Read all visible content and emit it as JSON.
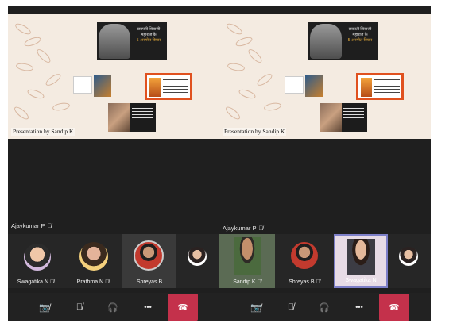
{
  "screens": {
    "left": {
      "slide_caption": "Presentation by Sandip K",
      "slide_title_line1": "छत्रपती शिवाजी",
      "slide_title_line2": "महाराज के",
      "slide_title_line3": "5 अनमोल विचार",
      "presenter_name": "Ajaykumar P",
      "participants": [
        {
          "name": "Swagatika N",
          "avatar": "avatar-photo",
          "muted": true
        },
        {
          "name": "Prathma N",
          "avatar": "avatar-photo",
          "muted": true
        },
        {
          "name": "Shreyas B",
          "avatar": "avatar-photo",
          "muted": false,
          "active": true
        },
        {
          "name": "",
          "avatar": "avatar-photo",
          "muted": false
        }
      ]
    },
    "right": {
      "slide_caption": "Presentation by Sandip K",
      "slide_title_line1": "छत्रपती शिवाजी",
      "slide_title_line2": "महाराज के",
      "slide_title_line3": "5 अनमोल विचार",
      "presenter_name": "Ajaykumar P",
      "participants": [
        {
          "name": "Sandip K",
          "avatar": "video-feed",
          "muted": true
        },
        {
          "name": "Shreyas B",
          "avatar": "avatar-photo",
          "muted": true
        },
        {
          "name": "Swagatika N",
          "avatar": "video-feed",
          "muted": false,
          "selected": true
        },
        {
          "name": "",
          "avatar": "avatar-photo",
          "muted": false
        }
      ]
    }
  },
  "icons": {
    "mic_off": "🎙̸",
    "camera_off": "📷̸",
    "speaker": "🎧",
    "more": "•••",
    "end_call": "☎"
  },
  "colors": {
    "background": "#1f1f1f",
    "end_call": "#c4314b",
    "selected_border": "#7d7fc8",
    "slide_accent": "#e0511f"
  }
}
